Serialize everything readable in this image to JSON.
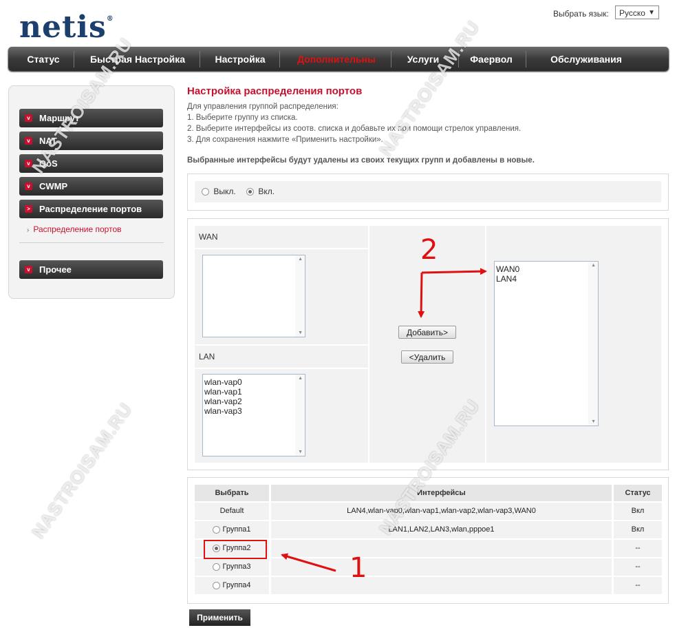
{
  "brand": {
    "logo_text": "netis",
    "logo_mark": "®"
  },
  "language": {
    "label": "Выбрать язык:",
    "selected": "Русско"
  },
  "nav": {
    "items": [
      "Статус",
      "Быстрая Настройка",
      "Настройка",
      "Дополнительны",
      "Услуги",
      "Фаервол",
      "Обслуживания"
    ],
    "active_index": 3
  },
  "sidebar": {
    "items": [
      "Маршрут",
      "NAT",
      "QoS",
      "CWMP",
      "Распределение портов",
      "Прочее"
    ],
    "sub_item": "Распределение портов"
  },
  "page": {
    "title": "Настройка распределения портов",
    "desc_lines": [
      "Для управления группой распределения:",
      "1. Выберите группу из списка.",
      "2. Выберите интерфейсы из соотв. списка и добавьте их при помощи стрелок управления.",
      "3. Для сохранения нажмите «Применить настройки»."
    ],
    "warning": "Выбранные интерфейсы будут удалены из своих текущих групп и добавлены в новые."
  },
  "mode": {
    "off_label": "Выкл.",
    "on_label": "Вкл.",
    "selected": "on"
  },
  "ports": {
    "wan_label": "WAN",
    "lan_label": "LAN",
    "wan_items": [],
    "lan_items": [
      "wlan-vap0",
      "wlan-vap1",
      "wlan-vap2",
      "wlan-vap3"
    ],
    "selected_items": [
      "WAN0",
      "LAN4"
    ],
    "add_button": "Добавить>",
    "remove_button": "<Удалить"
  },
  "groups_table": {
    "headers": [
      "Выбрать",
      "Интерфейсы",
      "Статус"
    ],
    "rows": [
      {
        "name": "Default",
        "interfaces": "LAN4,wlan-vap0,wlan-vap1,wlan-vap2,wlan-vap3,WAN0",
        "status": "Вкл"
      },
      {
        "name": "Группа1",
        "interfaces": "LAN1,LAN2,LAN3,wlan,pppoe1",
        "status": "Вкл"
      },
      {
        "name": "Группа2",
        "interfaces": "",
        "status": "--"
      },
      {
        "name": "Группа3",
        "interfaces": "",
        "status": "--"
      },
      {
        "name": "Группа4",
        "interfaces": "",
        "status": "--"
      }
    ],
    "selected_row": 2
  },
  "apply_button": "Применить",
  "annotations": {
    "step1": "1",
    "step2": "2",
    "color": "#e01010"
  },
  "watermark": "NASTROISAM.RU"
}
